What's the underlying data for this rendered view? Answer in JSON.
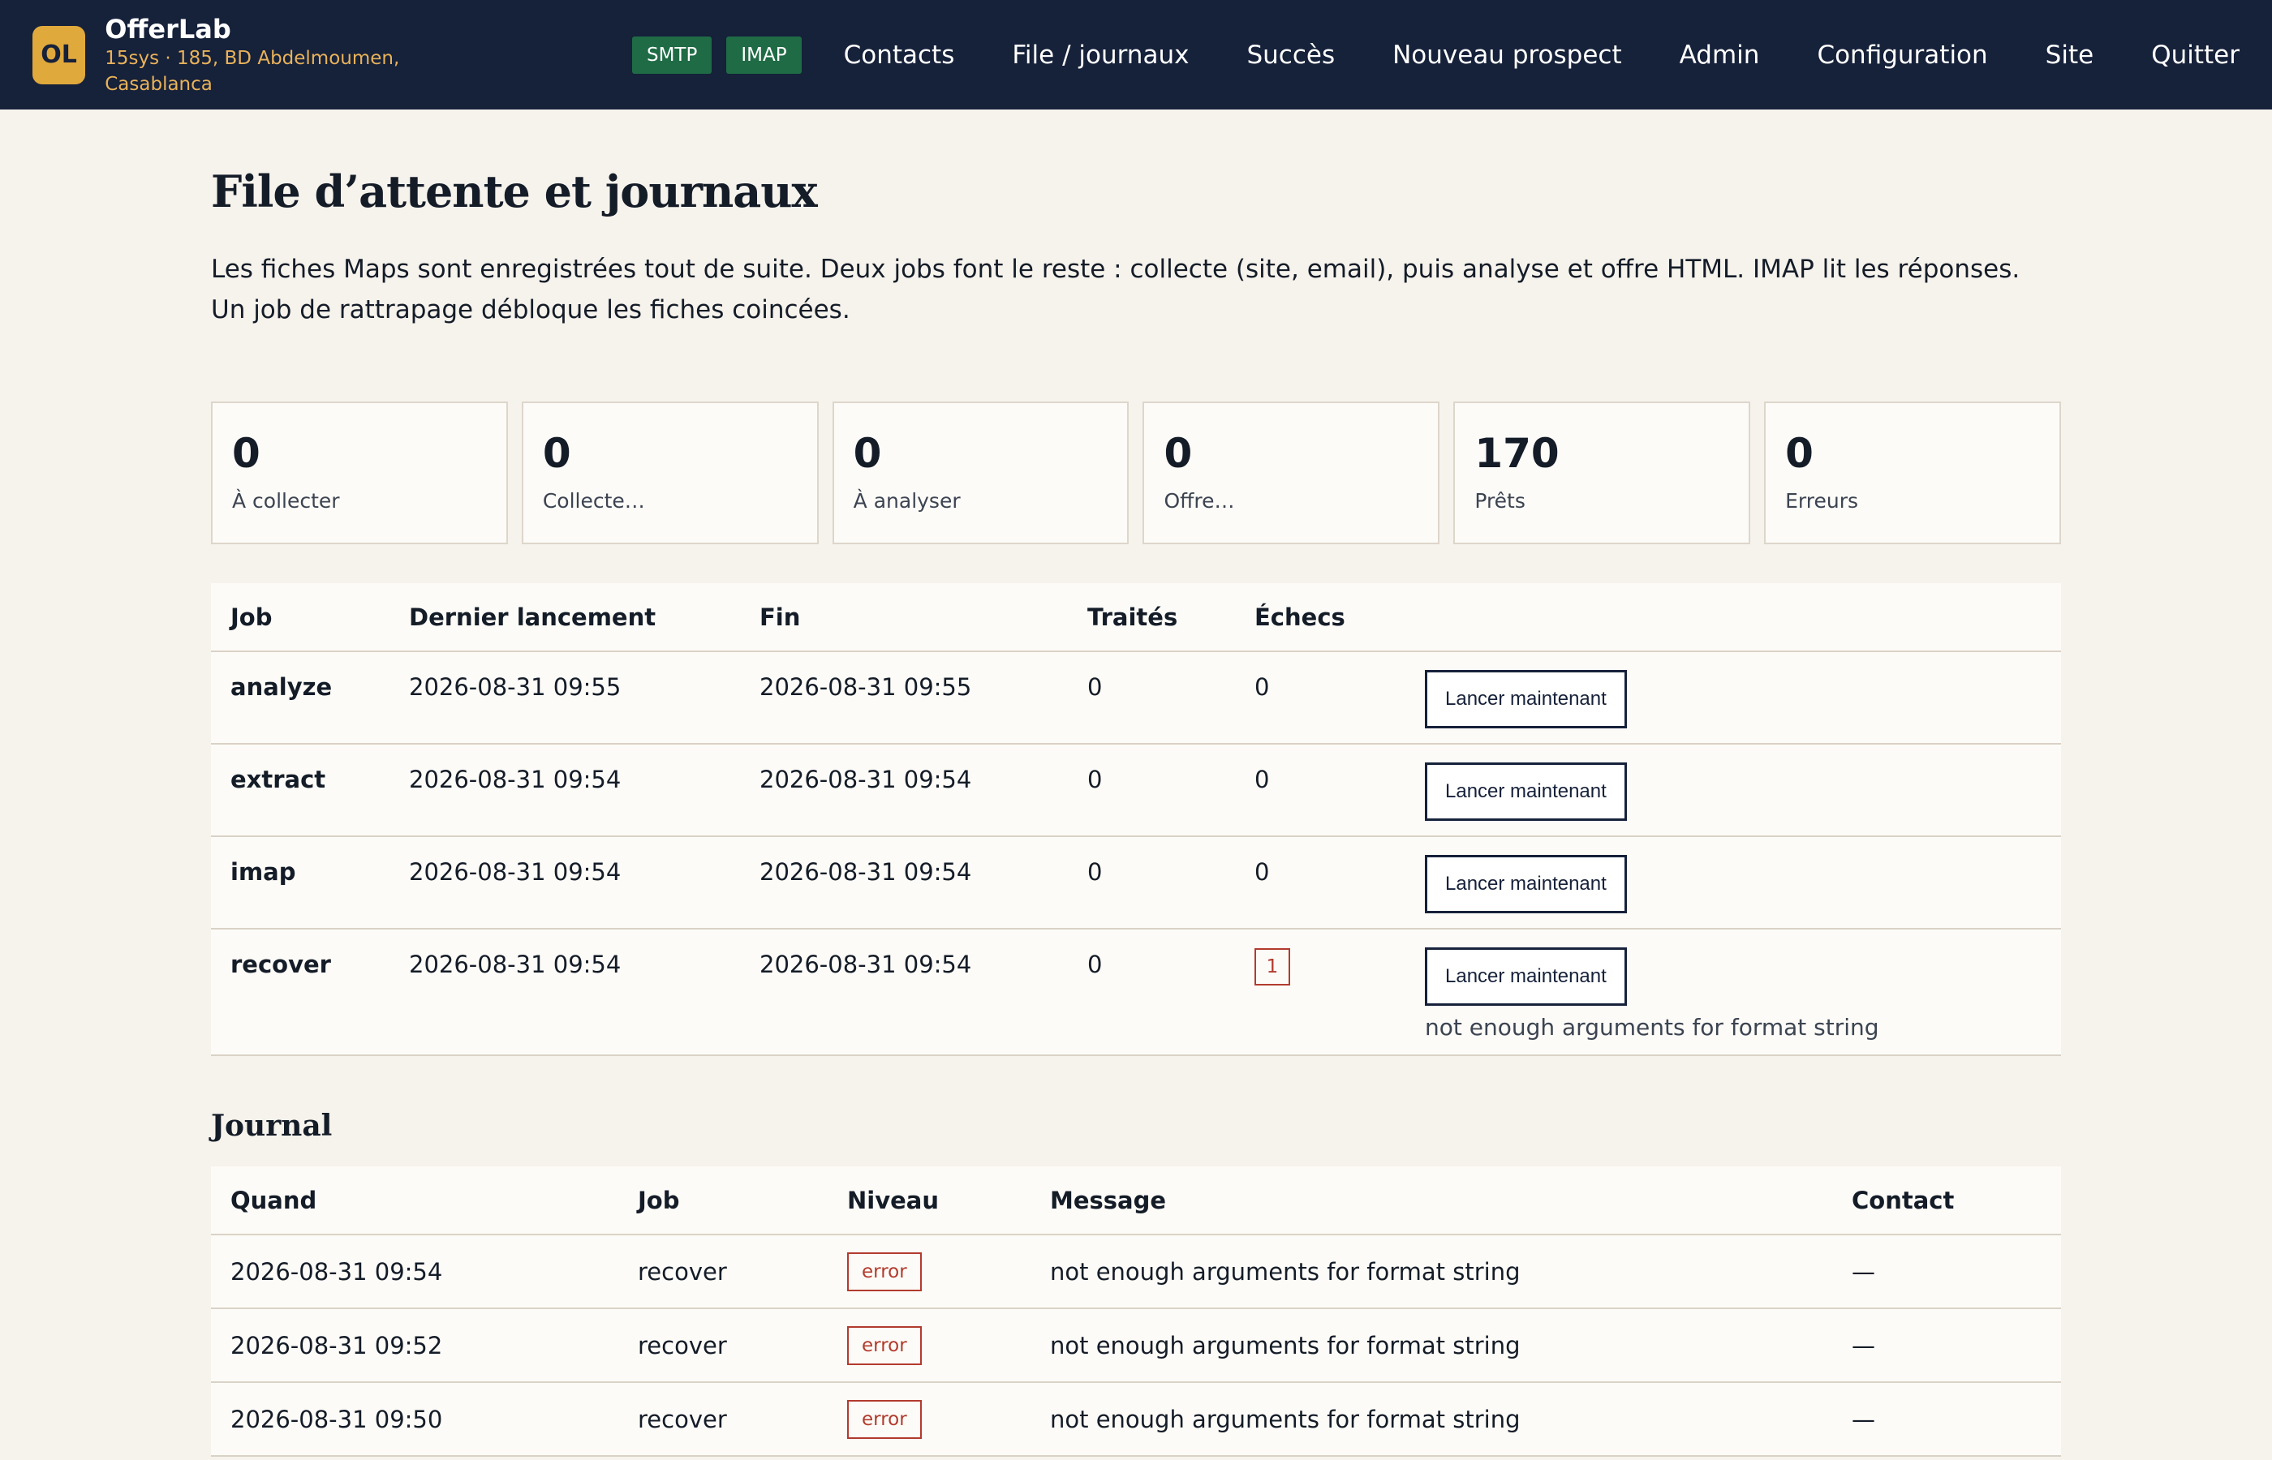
{
  "header": {
    "logo": "OL",
    "app_name": "OfferLab",
    "subtitle": "15sys · 185, BD Abdelmoumen, Casablanca",
    "badges": [
      "SMTP",
      "IMAP"
    ],
    "badge_color": "#1f6b45",
    "nav": [
      "Contacts",
      "File / journaux",
      "Succès",
      "Nouveau prospect",
      "Admin",
      "Configuration",
      "Site",
      "Quitter"
    ]
  },
  "page": {
    "title": "File d’attente et journaux",
    "intro": "Les fiches Maps sont enregistrées tout de suite. Deux jobs font le reste : collecte (site, email), puis analyse et offre HTML. IMAP lit les réponses. Un job de rattrapage débloque les fiches coincées."
  },
  "stats": [
    {
      "value": "0",
      "label": "À collecter"
    },
    {
      "value": "0",
      "label": "Collecte…"
    },
    {
      "value": "0",
      "label": "À analyser"
    },
    {
      "value": "0",
      "label": "Offre…"
    },
    {
      "value": "170",
      "label": "Prêts"
    },
    {
      "value": "0",
      "label": "Erreurs"
    }
  ],
  "jobs": {
    "headers": [
      "Job",
      "Dernier lancement",
      "Fin",
      "Traités",
      "Échecs",
      ""
    ],
    "run_label": "Lancer maintenant",
    "rows": [
      {
        "job": "analyze",
        "last": "2026-08-31 09:55",
        "end": "2026-08-31 09:55",
        "done": "0",
        "fails": "0"
      },
      {
        "job": "extract",
        "last": "2026-08-31 09:54",
        "end": "2026-08-31 09:54",
        "done": "0",
        "fails": "0"
      },
      {
        "job": "imap",
        "last": "2026-08-31 09:54",
        "end": "2026-08-31 09:54",
        "done": "0",
        "fails": "0"
      },
      {
        "job": "recover",
        "last": "2026-08-31 09:54",
        "end": "2026-08-31 09:54",
        "done": "0",
        "fails": "1",
        "error": "not enough arguments for format string"
      }
    ]
  },
  "journal": {
    "title": "Journal",
    "headers": [
      "Quand",
      "Job",
      "Niveau",
      "Message",
      "Contact"
    ],
    "rows": [
      {
        "when": "2026-08-31 09:54",
        "job": "recover",
        "level": "error",
        "message": "not enough arguments for format string",
        "contact": "—"
      },
      {
        "when": "2026-08-31 09:52",
        "job": "recover",
        "level": "error",
        "message": "not enough arguments for format string",
        "contact": "—"
      },
      {
        "when": "2026-08-31 09:50",
        "job": "recover",
        "level": "error",
        "message": "not enough arguments for format string",
        "contact": "—"
      }
    ]
  },
  "colors": {
    "header_bg": "#16213a",
    "accent": "#e0a93c",
    "error": "#b23b2e",
    "page_bg": "#f6f2ec"
  }
}
